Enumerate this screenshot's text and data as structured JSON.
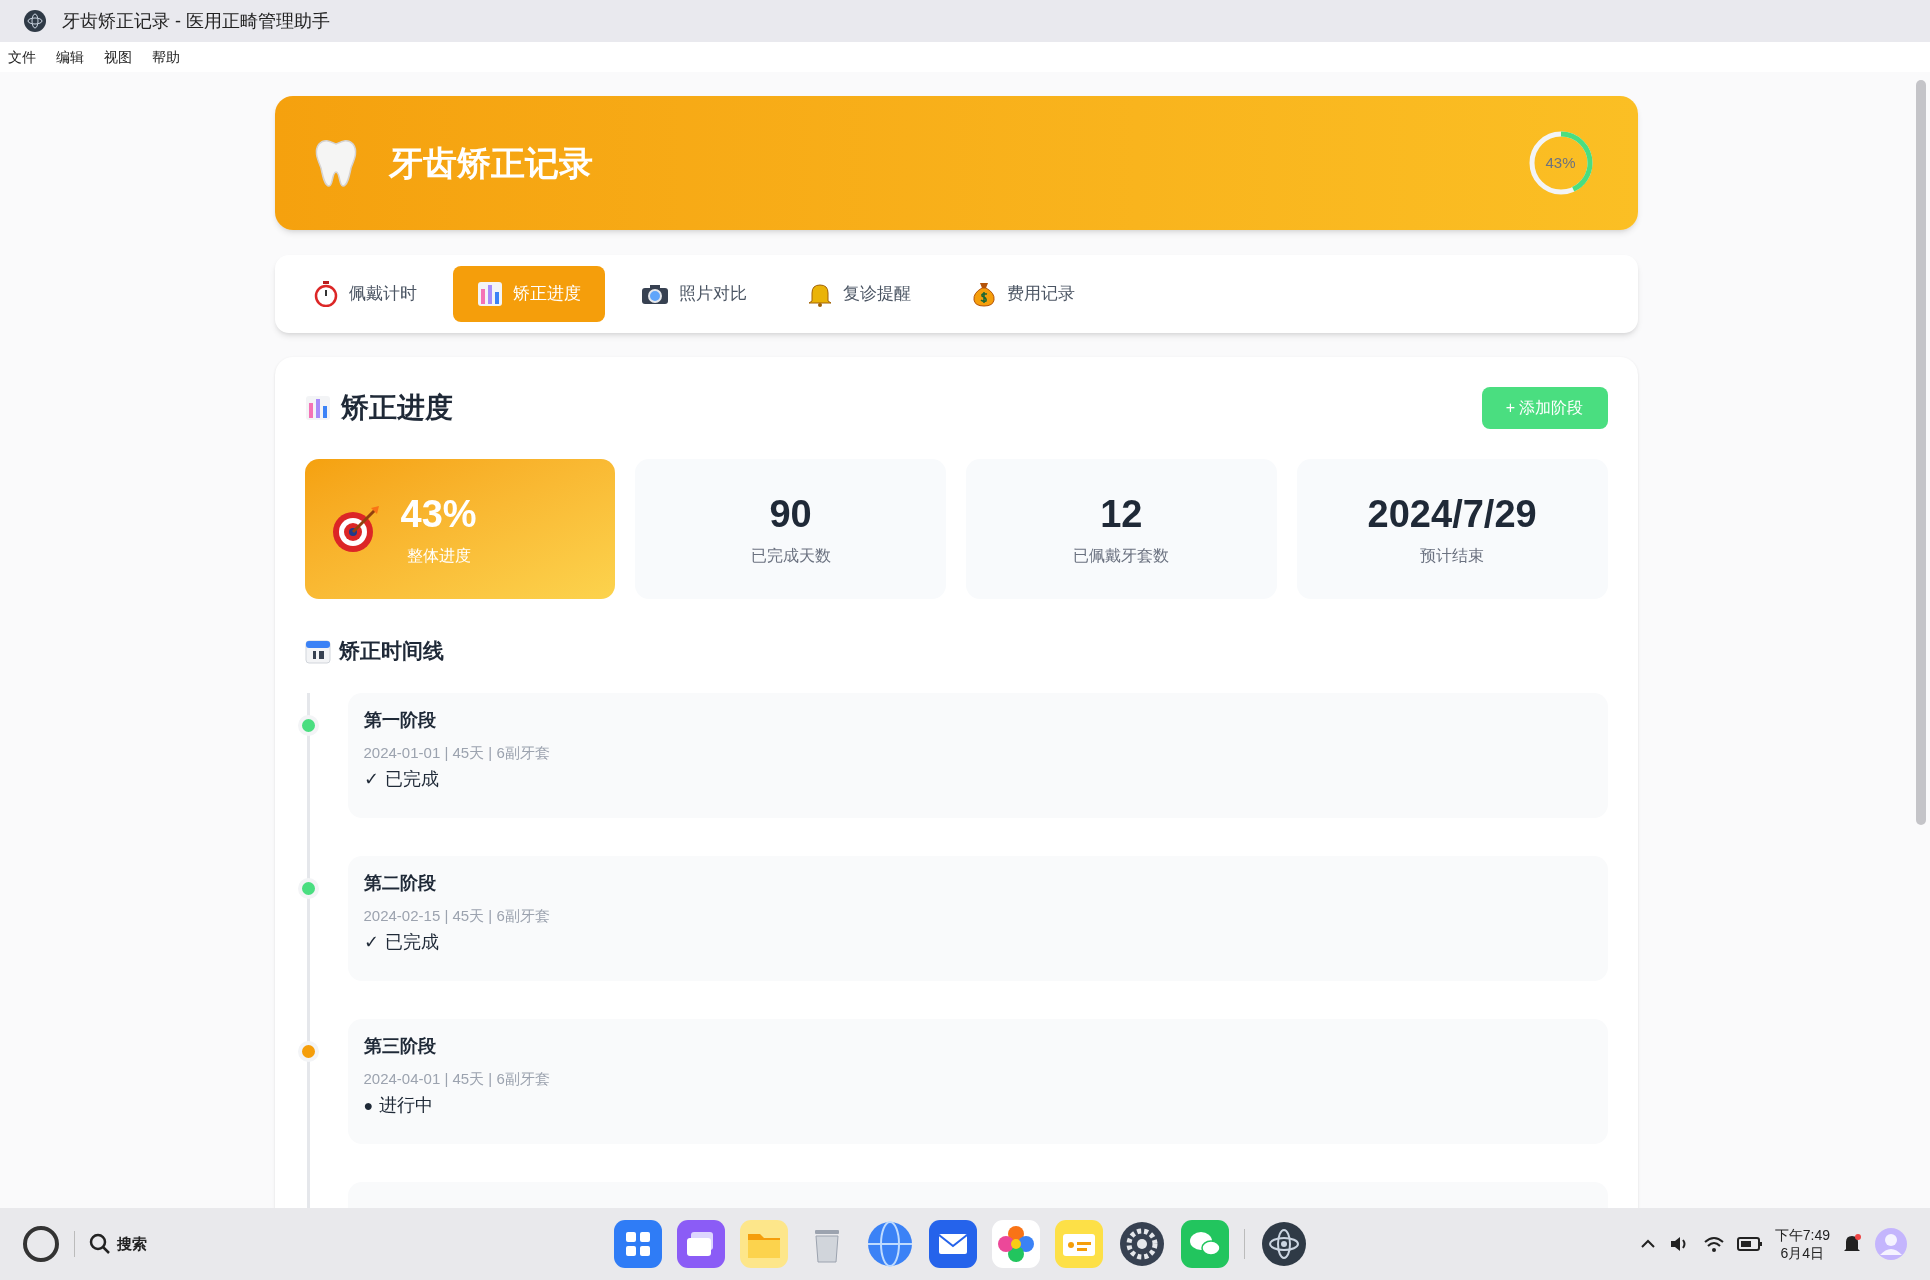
{
  "window": {
    "title": "牙齿矫正记录 - 医用正畸管理助手"
  },
  "menu": [
    "文件",
    "编辑",
    "视图",
    "帮助"
  ],
  "header": {
    "title": "牙齿矫正记录",
    "progress_label": "43%",
    "level": 0.43
  },
  "tabs": [
    {
      "label": "佩戴计时",
      "selected": false
    },
    {
      "label": "矫正进度",
      "selected": true
    },
    {
      "label": "照片对比",
      "selected": false
    },
    {
      "label": "复诊提醒",
      "selected": false
    },
    {
      "label": "费用记录",
      "selected": false
    }
  ],
  "section": {
    "title": "矫正进度",
    "add_button": "+ 添加阶段"
  },
  "stats": [
    {
      "value": "43%",
      "label": "整体进度",
      "kind": "highlight"
    },
    {
      "value": "90",
      "label": "已完成天数",
      "kind": "plain"
    },
    {
      "value": "12",
      "label": "已佩戴牙套数",
      "kind": "plain"
    },
    {
      "value": "2024/7/29",
      "label": "预计结束",
      "kind": "plain"
    }
  ],
  "timeline": {
    "title": "矫正时间线",
    "stages": [
      {
        "title": "第一阶段",
        "meta": "2024-01-01 | 45天 | 6副牙套",
        "completed": true,
        "status_mark": "✓",
        "status_text": "已完成"
      },
      {
        "title": "第二阶段",
        "meta": "2024-02-15 | 45天 | 6副牙套",
        "completed": true,
        "status_mark": "✓",
        "status_text": "已完成"
      },
      {
        "title": "第三阶段",
        "meta": "2024-04-01 | 45天 | 6副牙套",
        "completed": false,
        "status_mark": "●",
        "status_text": "进行中"
      }
    ]
  },
  "taskbar": {
    "search": "搜索",
    "time": "下午7:49",
    "date": "6月4日"
  }
}
